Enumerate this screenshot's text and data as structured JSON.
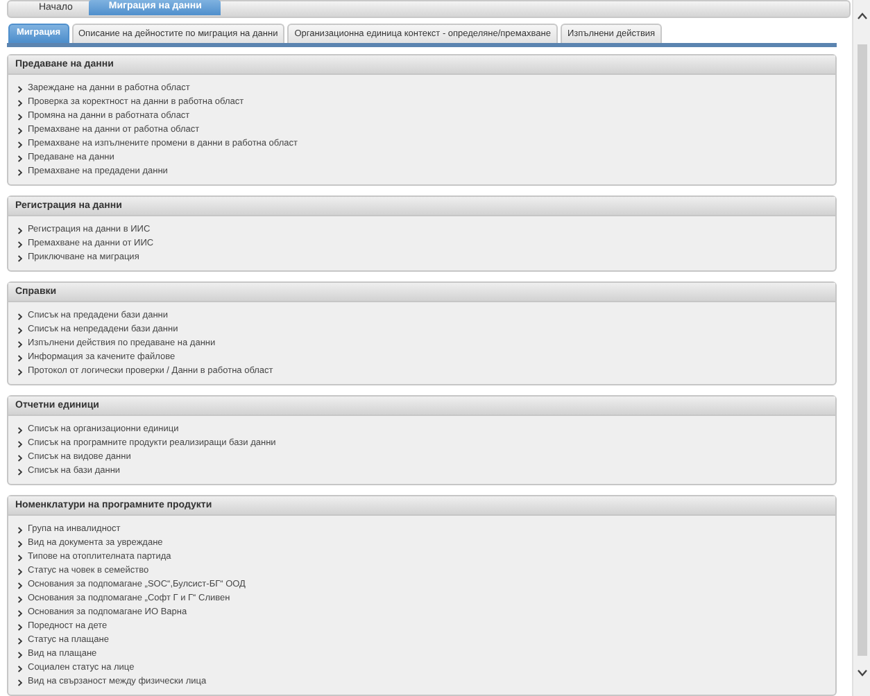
{
  "nav": [
    {
      "label": "Начало",
      "selected": false
    },
    {
      "label": "Миграция на данни",
      "selected": true
    }
  ],
  "tabs": [
    {
      "label": "Миграция",
      "selected": true
    },
    {
      "label": "Описание на дейностите по миграция на данни",
      "selected": false
    },
    {
      "label": "Организационна единица контекст - определяне/премахване",
      "selected": false
    },
    {
      "label": "Изпълнени действия",
      "selected": false
    }
  ],
  "panels": [
    {
      "title": "Предаване на данни",
      "items": [
        "Зареждане на данни в работна област",
        "Проверка за коректност на данни в работна област",
        "Промяна на данни в работната област",
        "Премахване на данни от работна област",
        "Премахване на изпълнените промени в данни в работна област",
        "Предаване на данни",
        "Премахване на предадени данни"
      ]
    },
    {
      "title": "Регистрация на данни",
      "items": [
        "Регистрация на данни в ИИС",
        "Премахване на данни от ИИС",
        "Приключване на миграция"
      ]
    },
    {
      "title": "Справки",
      "items": [
        "Списък на предадени бази данни",
        "Списък на непредадени бази данни",
        "Изпълнени действия по предаване на данни",
        "Информация за качените файлове",
        "Протокол от логически проверки / Данни в работна област"
      ]
    },
    {
      "title": "Отчетни единици",
      "items": [
        "Списък на организационни единици",
        "Списък на програмните продукти реализиращи бази данни",
        "Списък на видове данни",
        "Списък на бази данни"
      ]
    },
    {
      "title": "Номенклатури на програмните продукти",
      "items": [
        "Група на инвалидност",
        "Вид на документа за увреждане",
        "Типове на отоплителната партида",
        "Статус на човек в семейство",
        "Основания за подпомагане „SOC“,Булсист-БГ“ ООД",
        "Основания за подпомагане „Софт Г и Г“ Сливен",
        "Основания за подпомагане ИО Варна",
        "Поредност на дете",
        "Статус на плащане",
        "Вид на плащане",
        "Социален статус на лице",
        "Вид на свързаност между физически лица"
      ]
    }
  ]
}
